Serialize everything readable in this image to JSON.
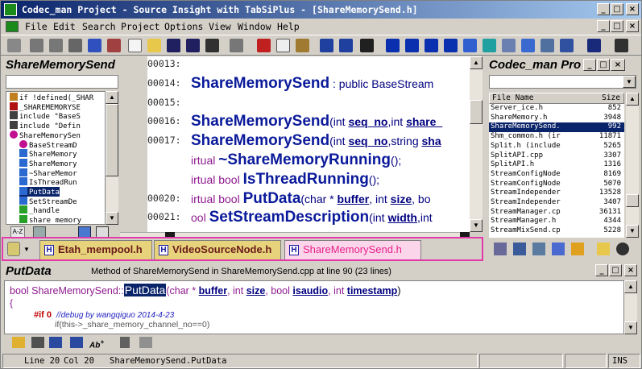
{
  "window": {
    "title": "Codec_man Project - Source Insight with TabSiPlus - [ShareMemorySend.h]"
  },
  "menu": [
    "File",
    "Edit",
    "Search",
    "Project",
    "Options",
    "View",
    "Window",
    "Help"
  ],
  "symbol_panel": {
    "title": "ShareMemorySend",
    "search": "",
    "items": [
      {
        "text": "if !defined(_SHAR",
        "icon": "brace-icon"
      },
      {
        "text": "_SHAREMEMORYSE",
        "icon": "hash-icon"
      },
      {
        "text": "include \"BaseS",
        "icon": "include-icon"
      },
      {
        "text": "include \"Defin",
        "icon": "include-icon"
      },
      {
        "text": "ShareMemorySen",
        "icon": "class-icon"
      },
      {
        "text": "BaseStreamD",
        "icon": "class-icon"
      },
      {
        "text": "ShareMemory",
        "icon": "method-icon"
      },
      {
        "text": "ShareMemory",
        "icon": "method-icon"
      },
      {
        "text": "~ShareMemor",
        "icon": "method-icon"
      },
      {
        "text": "IsThreadRun",
        "icon": "method-icon"
      },
      {
        "text": "PutData",
        "icon": "method-icon"
      },
      {
        "text": "SetStreamDe",
        "icon": "method-icon"
      },
      {
        "text": "_handle",
        "icon": "field-icon"
      },
      {
        "text": "share memory",
        "icon": "field-icon"
      }
    ],
    "bottom_buttons": [
      "sort-az-icon",
      "list-icon",
      "book-icon",
      "pages-icon"
    ]
  },
  "editor": {
    "lines": [
      {
        "num": "00013:",
        "parts": []
      },
      {
        "num": "00014:",
        "parts": [
          {
            "t": "ShareMemorySend",
            "c": "big"
          },
          {
            "t": " : public BaseStream",
            "c": "norm"
          }
        ]
      },
      {
        "num": "00015:",
        "parts": []
      },
      {
        "num": "00016:",
        "parts": [
          {
            "t": "ShareMemorySend",
            "c": "big"
          },
          {
            "t": "(int ",
            "c": "norm"
          },
          {
            "t": "seq_no",
            "c": "param"
          },
          {
            "t": ",int ",
            "c": "norm"
          },
          {
            "t": "share_",
            "c": "param"
          }
        ]
      },
      {
        "num": "00017:",
        "parts": [
          {
            "t": "ShareMemorySend",
            "c": "big"
          },
          {
            "t": "(int ",
            "c": "norm"
          },
          {
            "t": "seq_no",
            "c": "param"
          },
          {
            "t": ",string ",
            "c": "norm"
          },
          {
            "t": "sha",
            "c": "param"
          }
        ]
      },
      {
        "num": "",
        "parts": [
          {
            "t": "irtual ",
            "c": "kw"
          },
          {
            "t": "~ShareMemoryRunning",
            "c": "big"
          },
          {
            "t": "();",
            "c": "norm"
          }
        ]
      },
      {
        "num": "",
        "parts": [
          {
            "t": "irtual bool ",
            "c": "kw"
          },
          {
            "t": "IsThreadRunning",
            "c": "big"
          },
          {
            "t": "();",
            "c": "norm"
          }
        ]
      },
      {
        "num": "00020:",
        "parts": [
          {
            "t": "irtual bool ",
            "c": "kw"
          },
          {
            "t": "PutData",
            "c": "big"
          },
          {
            "t": "(char * ",
            "c": "norm"
          },
          {
            "t": "buffer",
            "c": "param"
          },
          {
            "t": ", int ",
            "c": "norm"
          },
          {
            "t": "size",
            "c": "param"
          },
          {
            "t": ", bo",
            "c": "norm"
          }
        ]
      },
      {
        "num": "00021:",
        "parts": [
          {
            "t": "ool ",
            "c": "kw"
          },
          {
            "t": "SetStreamDescription",
            "c": "big"
          },
          {
            "t": "(int ",
            "c": "norm"
          },
          {
            "t": "width",
            "c": "param"
          },
          {
            "t": ",int",
            "c": "norm"
          }
        ]
      },
      {
        "num": "00022:",
        "parts": [
          {
            "t": "e:",
            "c": "norm"
          }
        ]
      }
    ]
  },
  "project_panel": {
    "title": "Codec_man Pro",
    "search": "",
    "col_name": "File Name",
    "col_size": "Size",
    "selected_index": 2,
    "files": [
      {
        "name": "Server_ice.h",
        "size": "852"
      },
      {
        "name": "ShareMemory.h",
        "size": "3948"
      },
      {
        "name": "ShareMemorySend.",
        "size": "992"
      },
      {
        "name": "Shm_common.h (ir",
        "size": "11871"
      },
      {
        "name": "Split.h (include",
        "size": "5265"
      },
      {
        "name": "SplitAPI.cpp",
        "size": "3307"
      },
      {
        "name": "SplitAPI.h",
        "size": "1316"
      },
      {
        "name": "StreamConfigNode",
        "size": "8169"
      },
      {
        "name": "StreamConfigNode",
        "size": "5070"
      },
      {
        "name": "StreamIndepender",
        "size": "13528"
      },
      {
        "name": "StreamIndepender",
        "size": "3407"
      },
      {
        "name": "StreamManager.cp",
        "size": "36131"
      },
      {
        "name": "StreamManager.h",
        "size": "4344"
      },
      {
        "name": "StreamMixSend.cp",
        "size": "5228"
      }
    ]
  },
  "tabs": [
    {
      "label": "Etah_mempool.h",
      "active": false
    },
    {
      "label": "VideoSourceNode.h",
      "active": false
    },
    {
      "label": "ShareMemorySend.h",
      "active": true
    }
  ],
  "context": {
    "title": "PutData",
    "info": "Method of ShareMemorySend in ShareMemorySend.cpp at line 90 (23 lines)",
    "line1": {
      "prefix": "bool ShareMemorySend::",
      "highlight": "PutData",
      "rest1": "(char * ",
      "p1": "buffer",
      "rest2": ", int ",
      "p2": "size",
      "rest3": ", bool ",
      "p3": "isaudio",
      "rest4": ", int ",
      "p4": "timestamp",
      "end": ")"
    },
    "line2": "{",
    "line3": {
      "kw": "#if 0",
      "comment": "//debug by wangqiguo 2014-4-23"
    },
    "line4": "if(this->_share_memory_channel_no==0)"
  },
  "status": {
    "line": "Line 20",
    "col": "Col 20",
    "symbol": "ShareMemorySend.PutData",
    "mode": "INS"
  },
  "colors": {
    "accent": "#0a246a",
    "tab_active": "#e8208a",
    "keyword": "#8e1a8e",
    "param": "#000080",
    "big": "#0a1a9a"
  }
}
